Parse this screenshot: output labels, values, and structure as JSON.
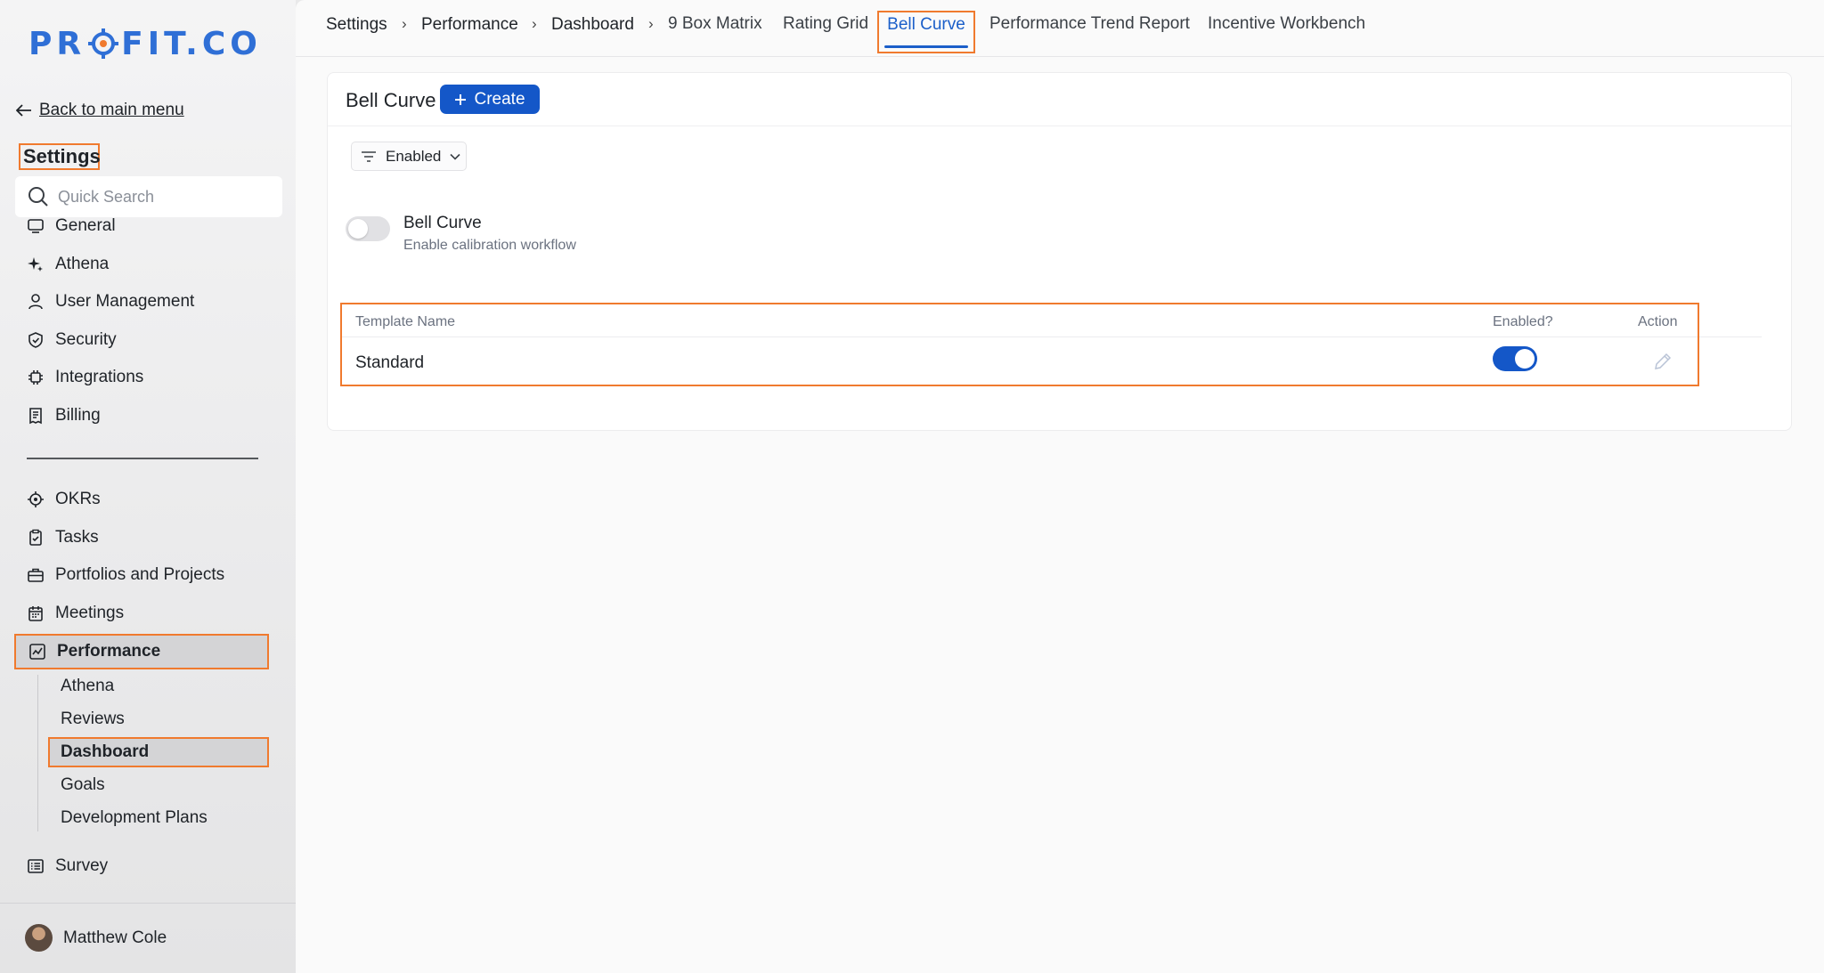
{
  "sidebar": {
    "logo_text": "PROFIT.CO",
    "back_link": "Back to main menu",
    "settings_title": "Settings",
    "search_placeholder": "Quick Search",
    "items_top": [
      {
        "label": "General",
        "icon": "monitor-icon"
      },
      {
        "label": "Athena",
        "icon": "sparkle-icon"
      },
      {
        "label": "User Management",
        "icon": "user-icon"
      },
      {
        "label": "Security",
        "icon": "shield-icon"
      },
      {
        "label": "Integrations",
        "icon": "chip-icon"
      },
      {
        "label": "Billing",
        "icon": "receipt-icon"
      }
    ],
    "items_bottom": [
      {
        "label": "OKRs",
        "icon": "target-icon"
      },
      {
        "label": "Tasks",
        "icon": "clipboard-check-icon"
      },
      {
        "label": "Portfolios and Projects",
        "icon": "briefcase-icon"
      },
      {
        "label": "Meetings",
        "icon": "calendar-icon"
      }
    ],
    "performance": {
      "label": "Performance",
      "icon": "chart-line-icon"
    },
    "performance_sub": [
      "Athena",
      "Reviews",
      "Dashboard",
      "Goals",
      "Development Plans"
    ],
    "survey": {
      "label": "Survey",
      "icon": "list-icon"
    },
    "user_name": "Matthew Cole"
  },
  "top_nav": {
    "breadcrumbs": [
      "Settings",
      "Performance",
      "Dashboard"
    ],
    "separator": "›",
    "tabs": [
      "9 Box Matrix",
      "Rating Grid",
      "Bell Curve",
      "Performance Trend Report",
      "Incentive Workbench"
    ],
    "active_tab": "Bell Curve"
  },
  "card": {
    "title": "Bell Curve",
    "create_label": "Create",
    "filter_label": "Enabled",
    "toggle_title": "Bell Curve",
    "toggle_subtitle": "Enable calibration workflow",
    "toggle_enabled": false,
    "table": {
      "columns": [
        "Template Name",
        "Enabled?",
        "Action"
      ],
      "rows": [
        {
          "name": "Standard",
          "enabled": true
        }
      ]
    }
  },
  "colors": {
    "accent": "#1457c8",
    "highlight": "#f07a2e",
    "logo": "#2f6fd6"
  }
}
